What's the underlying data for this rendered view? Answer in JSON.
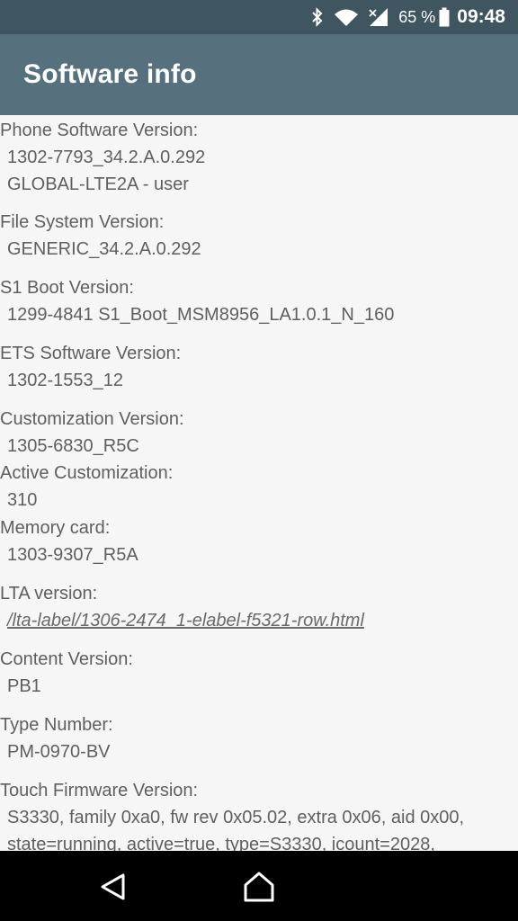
{
  "status_bar": {
    "battery_percent": "65 %",
    "time": "09:48",
    "icons": [
      "bluetooth-icon",
      "wifi-icon",
      "signal-icon",
      "battery-icon"
    ]
  },
  "app_bar": {
    "title": "Software info"
  },
  "items": [
    {
      "label": "Phone Software Version:",
      "values": [
        "1302-7793_34.2.A.0.292",
        "GLOBAL-LTE2A - user"
      ]
    },
    {
      "label": "File System Version:",
      "values": [
        "GENERIC_34.2.A.0.292"
      ]
    },
    {
      "label": "S1 Boot Version:",
      "values": [
        "1299-4841 S1_Boot_MSM8956_LA1.0.1_N_160"
      ]
    },
    {
      "label": "ETS Software Version:",
      "values": [
        "1302-1553_12"
      ]
    },
    {
      "label": "Customization Version:",
      "values": [
        "1305-6830_R5C"
      ]
    },
    {
      "label": "Active Customization:",
      "values": [
        "310"
      ]
    },
    {
      "label": "Memory card:",
      "values": [
        "1303-9307_R5A"
      ]
    },
    {
      "label": "LTA version:",
      "values": [
        "/lta-label/1306-2474_1-elabel-f5321-row.html"
      ]
    },
    {
      "label": "Content Version:",
      "values": [
        "PB1"
      ]
    },
    {
      "label": "Type Number:",
      "values": [
        "PM-0970-BV"
      ]
    },
    {
      "label": "Touch Firmware Version:",
      "values": [
        "S3330, family 0xa0, fw rev 0x05.02, extra 0x06, aid 0x00, state=running, active=true, type=S3330, icount=2028,"
      ]
    }
  ],
  "nav_bar": {
    "icons": [
      "back-icon",
      "home-icon",
      "recents-icon"
    ]
  }
}
